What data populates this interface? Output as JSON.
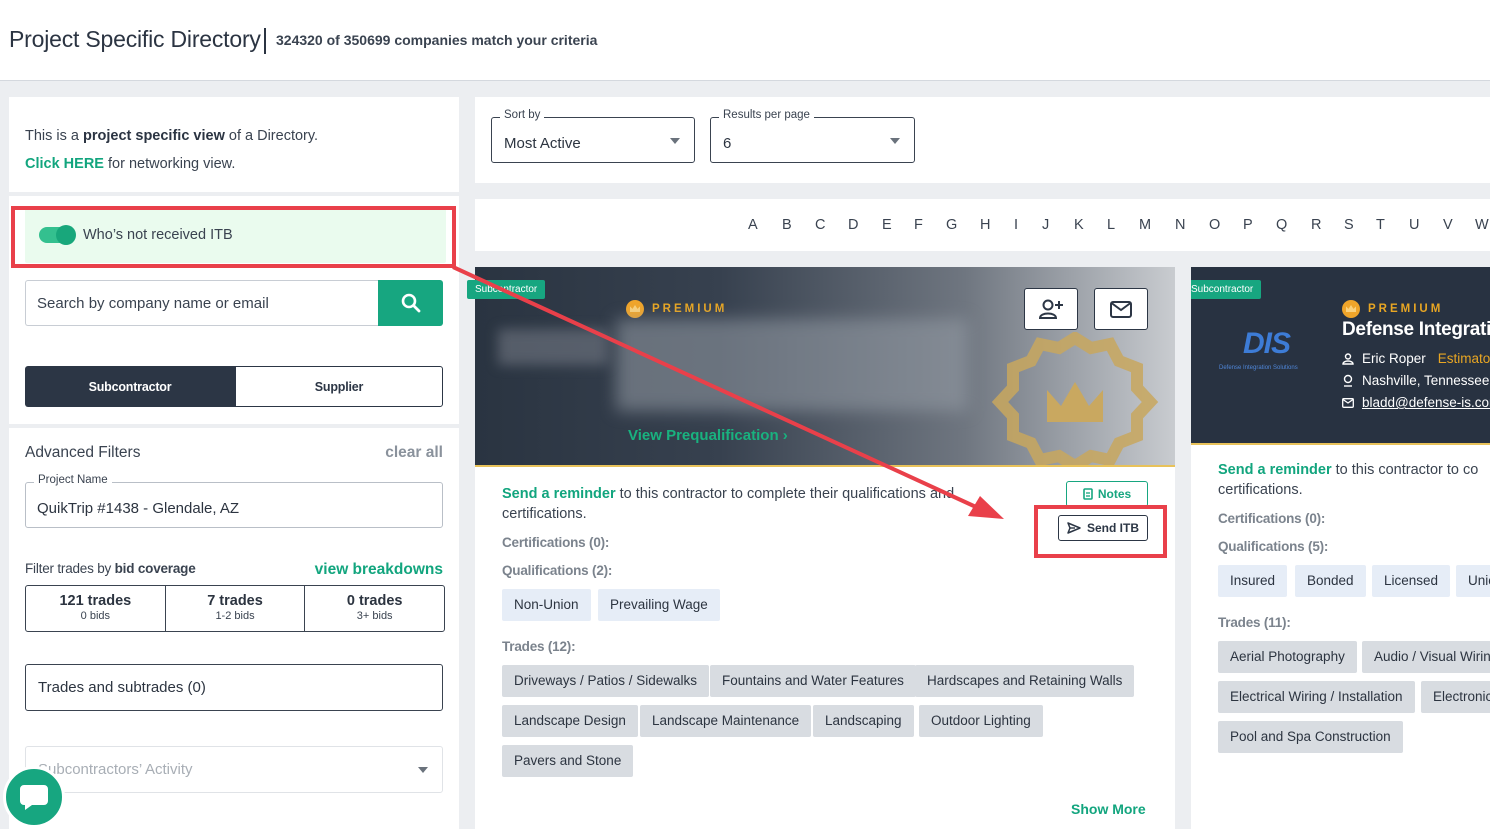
{
  "header": {
    "title": "Project Specific Directory",
    "match_count": "324320 of 350699 companies match your criteria"
  },
  "intro": {
    "prefix": "This is a ",
    "bold": "project specific view",
    "suffix": " of a Directory.",
    "link": "Click HERE",
    "link_suffix": " for networking view."
  },
  "filters": {
    "itb_toggle_label": "Who’s not received ITB",
    "itb_toggle_on": true,
    "search_placeholder": "Search by company name or email",
    "segments": [
      "Subcontractor",
      "Supplier"
    ],
    "selected_segment": "Subcontractor",
    "advanced_title": "Advanced Filters",
    "clear_all": "clear all",
    "project_label": "Project Name",
    "project_value": "QuikTrip #1438 - Glendale, AZ",
    "bid_label_prefix": "Filter trades by ",
    "bid_label_bold": "bid coverage",
    "view_breakdowns": "view breakdowns",
    "bid_coverage": [
      {
        "count": "121 trades",
        "sub": "0 bids"
      },
      {
        "count": "7 trades",
        "sub": "1-2 bids"
      },
      {
        "count": "0 trades",
        "sub": "3+ bids"
      }
    ],
    "trades_select": "Trades and subtrades (0)",
    "activity_select": "Subcontractors’ Activity"
  },
  "sort": {
    "sort_label": "Sort by",
    "sort_value": "Most Active",
    "results_label": "Results per page",
    "results_value": "6"
  },
  "alphabet": [
    "A",
    "B",
    "C",
    "D",
    "E",
    "F",
    "G",
    "H",
    "I",
    "J",
    "K",
    "L",
    "M",
    "N",
    "O",
    "P",
    "Q",
    "R",
    "S",
    "T",
    "U",
    "V",
    "W"
  ],
  "cards": [
    {
      "type": "Subcontractor",
      "premium": "PREMIUM",
      "view_prequal": "View Prequalification ›",
      "reminder_link": "Send a reminder",
      "reminder_text": " to this contractor to complete their qualifications and certifications.",
      "notes": "Notes",
      "send_itb": "Send ITB",
      "certifications": "Certifications (0):",
      "qualifications": "Qualifications (2):",
      "qualification_tags": [
        "Non-Union",
        "Prevailing Wage"
      ],
      "trades_label": "Trades (12):",
      "trade_tags": [
        "Driveways / Patios / Sidewalks",
        "Fountains and Water Features",
        "Hardscapes and Retaining Walls",
        "Landscape Design",
        "Landscape Maintenance",
        "Landscaping",
        "Outdoor Lighting",
        "Pavers and Stone"
      ],
      "show_more": "Show More"
    },
    {
      "type": "Subcontractor",
      "premium": "PREMIUM",
      "company_name": "Defense Integration",
      "contact_name": "Eric Roper",
      "contact_role": "Estimator",
      "location": "Nashville, Tennessee",
      "email": "bladd@defense-is.cor",
      "logo_text": "DIS",
      "logo_sub": "Defense Integration Solutions",
      "reminder_link": "Send a reminder",
      "reminder_text": " to this contractor to co",
      "reminder_text2": "certifications.",
      "certifications": "Certifications (0):",
      "qualifications": "Qualifications (5):",
      "qualification_tags": [
        "Insured",
        "Bonded",
        "Licensed",
        "Unio"
      ],
      "trades_label": "Trades (11):",
      "trade_tags": [
        "Aerial Photography",
        "Audio / Visual Wiring",
        "Electrical Wiring / Installation",
        "Electronic",
        "Pool and Spa Construction"
      ]
    }
  ],
  "colors": {
    "accent_green": "#17a680",
    "dark_navy": "#2c3645",
    "annotation_red": "#e9404a",
    "premium_gold": "#e8a623"
  }
}
